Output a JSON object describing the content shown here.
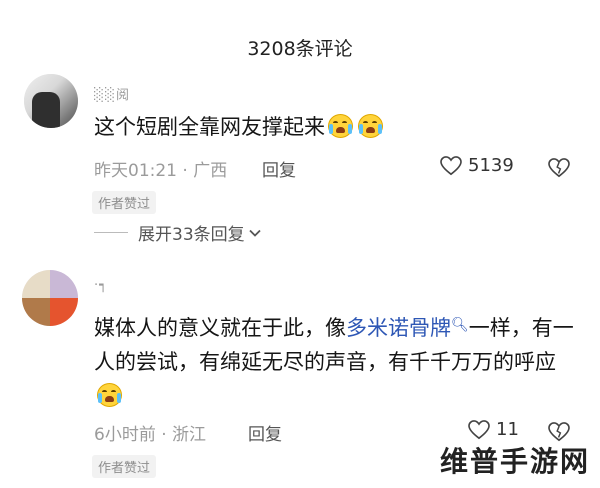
{
  "header": {
    "title": "3208条评论"
  },
  "comments": [
    {
      "username": "░░阅",
      "text": "这个短剧全靠网友撑起来",
      "emojis": [
        "crying-face-emoji",
        "crying-face-emoji"
      ],
      "time": "昨天01:21",
      "location": "广西",
      "reply_label": "回复",
      "likes": "5139",
      "badge": "作者赞过",
      "expand_label": "展开33条回复"
    },
    {
      "username": "·┑",
      "text_before_link": "媒体人的意义就在于此，像",
      "link_text": "多米诺骨牌",
      "text_after_link": "一样，有一人的尝试，有绵延无尽的声音，有千千万万的呼应",
      "emojis": [
        "crying-face-emoji"
      ],
      "time": "6小时前",
      "location": "浙江",
      "reply_label": "回复",
      "likes": "11",
      "badge": "作者赞过"
    }
  ],
  "watermark": "维普手游网",
  "colors": {
    "link": "#2e57b5",
    "meta": "#9b9b9b",
    "badge_bg": "#f2f2f2"
  }
}
